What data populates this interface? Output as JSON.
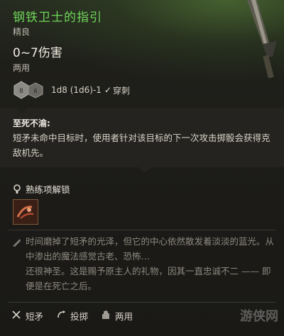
{
  "item": {
    "name": "钢铁卫士的指引",
    "rarity": "精良",
    "damage_range": "0~7伤害",
    "handedness": "两用",
    "dice_formula": "1d8 (1d6)-1",
    "damage_type": "穿刺",
    "dice_faces": [
      "8",
      "6"
    ]
  },
  "feature": {
    "name": "至死不渝:",
    "description": "短矛未命中目标时，使用者针对该目标的下一次攻击掷骰会获得克敌机先。"
  },
  "unlock": {
    "label": "熟练项解锁"
  },
  "lore": {
    "text": "时间磨掉了短矛的光泽，但它的中心依然散发着淡淡的蓝光。从中渗出的魔法感觉古老、恐怖…\n还很神圣。这是赐予原主人的礼物，因其一直忠诚不二 —— 即便是在死亡之后。"
  },
  "footer": {
    "items": [
      {
        "label": "短矛",
        "icon": "spear-icon"
      },
      {
        "label": "投掷",
        "icon": "throw-icon"
      },
      {
        "label": "两用",
        "icon": "hand-icon"
      }
    ]
  },
  "watermark": "游侠网",
  "colors": {
    "title": "#6fd65a",
    "background": "#1c1b18"
  }
}
